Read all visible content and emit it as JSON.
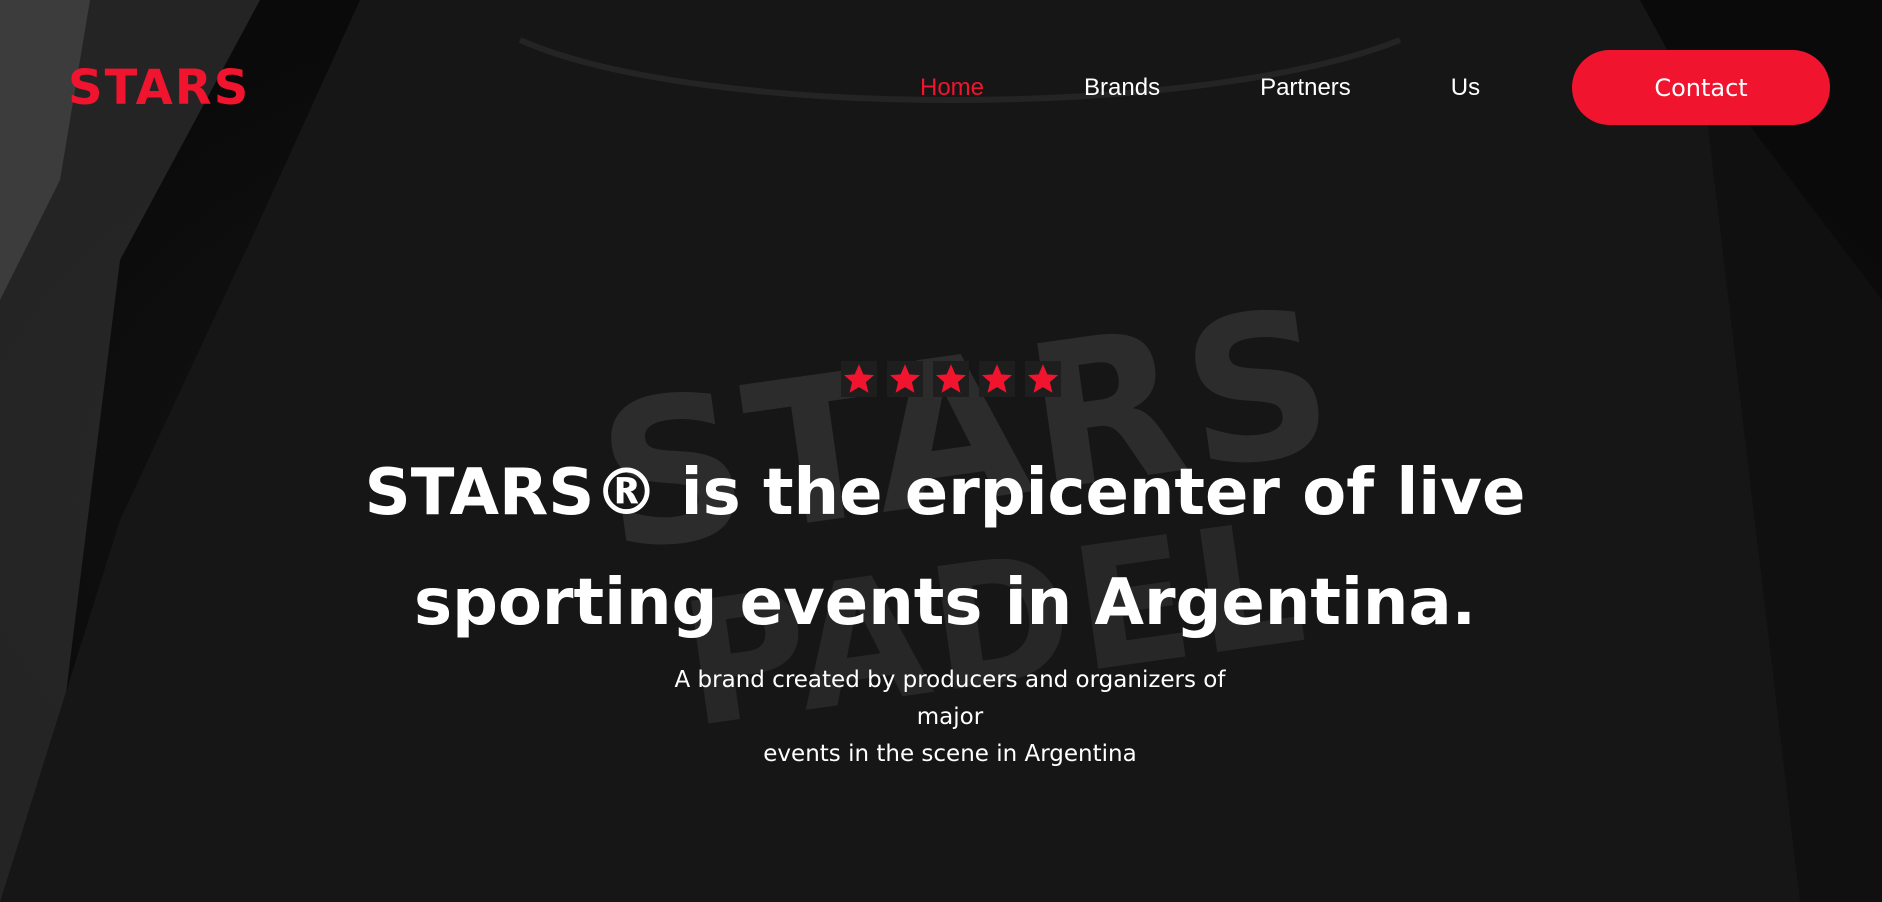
{
  "brand": {
    "logo_text": "STARS",
    "accent_color": "#f0142f"
  },
  "nav": {
    "items": [
      {
        "label": "Home",
        "active": true
      },
      {
        "label": "Brands",
        "active": false
      },
      {
        "label": "Partners",
        "active": false
      },
      {
        "label": "Us",
        "active": false
      }
    ],
    "contact_label": "Contact"
  },
  "hero": {
    "rating_icon": "star-icon",
    "rating_count": 5,
    "background_text": [
      "STARS",
      "PADEL"
    ],
    "headline_line1": "STARS® is the erpicenter of live",
    "headline_line2": "sporting events in Argentina.",
    "subtitle_line1": "A brand created by producers and organizers of major",
    "subtitle_line2": "events in the scene in Argentina"
  }
}
